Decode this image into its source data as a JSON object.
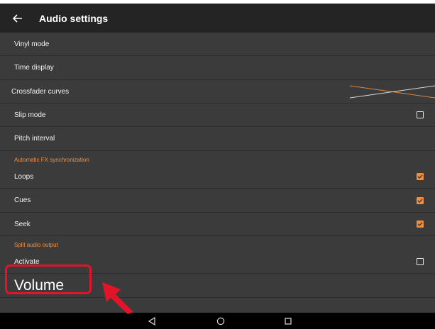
{
  "appbar": {
    "title": "Audio settings",
    "back_icon": "arrow-left-icon"
  },
  "settings": {
    "vinyl_mode": "Vinyl mode",
    "time_display": "Time display",
    "crossfader_curves": "Crossfader curves",
    "slip_mode": {
      "label": "Slip mode",
      "checked": false
    },
    "pitch_interval": "Pitch interval",
    "fx_header": "Automatic FX synchronization",
    "loops": {
      "label": "Loops",
      "checked": true
    },
    "cues": {
      "label": "Cues",
      "checked": true
    },
    "seek": {
      "label": "Seek",
      "checked": true
    },
    "split_header": "Split audio output",
    "activate": {
      "label": "Activate",
      "checked": false
    },
    "volume": "Volume"
  },
  "colors": {
    "accent": "#f08c3c",
    "highlight": "#e2142a",
    "background": "#3b3b3b",
    "appbar": "#242424"
  },
  "navbar": {
    "back_icon": "triangle-back-icon",
    "home_icon": "circle-home-icon",
    "recents_icon": "square-recents-icon"
  }
}
